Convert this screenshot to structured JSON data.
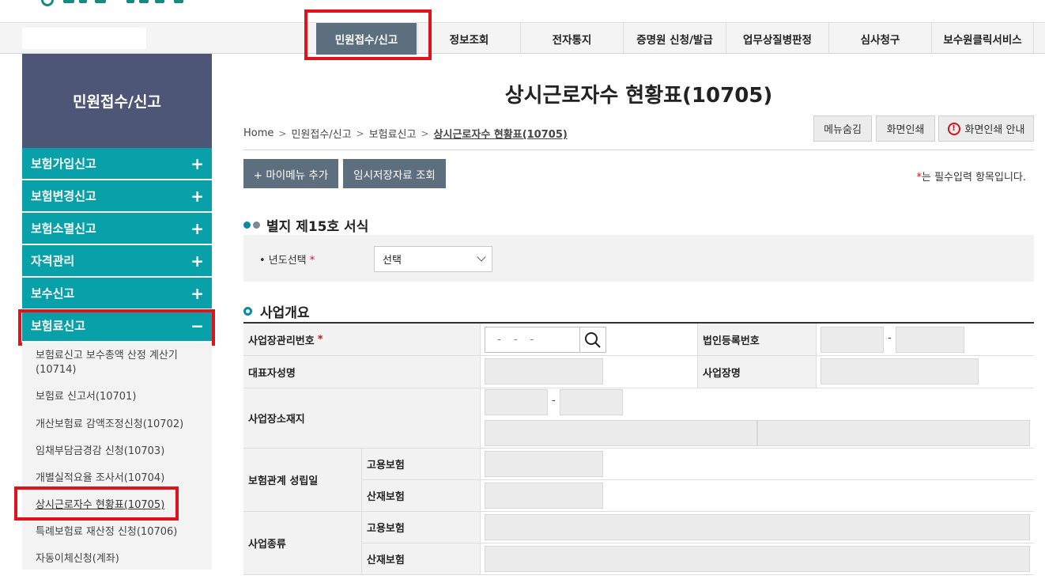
{
  "gnb": {
    "items": [
      "민원접수/신고",
      "정보조회",
      "전자통지",
      "증명원 신청/발급",
      "업무상질병판정",
      "심사청구",
      "보수원클릭서비스"
    ]
  },
  "sidebar": {
    "title": "민원접수/신고",
    "items": [
      {
        "label": "보험가입신고",
        "toggle": "+"
      },
      {
        "label": "보험변경신고",
        "toggle": "+"
      },
      {
        "label": "보험소멸신고",
        "toggle": "+"
      },
      {
        "label": "자격관리",
        "toggle": "+"
      },
      {
        "label": "보수신고",
        "toggle": "+"
      },
      {
        "label": "보험료신고",
        "toggle": "−"
      }
    ],
    "sub_items": [
      "보험료신고 보수총액 산정 계산기\n(10714)",
      "보험료 신고서(10701)",
      "개산보험료 감액조정신청(10702)",
      "임채부담금경감 신청(10703)",
      "개별실적요율 조사서(10704)",
      "상시근로자수 현황표(10705)",
      "특례보험료 재산정 신청(10706)",
      "자동이체신청(계좌)"
    ]
  },
  "page": {
    "title": "상시근로자수 현황표(10705)",
    "breadcrumb": [
      "Home",
      "민원접수/신고",
      "보험료신고",
      "상시근로자수 현황표(10705)"
    ],
    "util_buttons": {
      "hide_menu": "메뉴숨김",
      "print": "화면인쇄",
      "print_guide": "화면인쇄 안내",
      "warn_glyph": "!"
    },
    "add_mymenu": "+ 마이메뉴 추가",
    "temp_lookup": "임시저장자료 조회",
    "required_star": "*",
    "required_note": "는 필수입력 항목입니다."
  },
  "form15": {
    "title": "별지 제15호 서식",
    "year_label": "• 년도선택",
    "year_value": "선택"
  },
  "business": {
    "title": "사업개요",
    "rows": {
      "mgmt_no": "사업장관리번호",
      "mgmt_no_placeholder": "- - -",
      "corp_reg": "법인등록번호",
      "rep_name": "대표자성명",
      "biz_name": "사업장명",
      "address": "사업장소재지",
      "est_date": "보험관계 성립일",
      "biz_type": "사업종류",
      "employment": "고용보험",
      "accident": "산재보험",
      "dash": "-"
    }
  },
  "colors": {
    "teal": "#08a0a9",
    "navy": "#4e5677",
    "slate": "#5d6f7e",
    "highlight": "#e0121b"
  }
}
